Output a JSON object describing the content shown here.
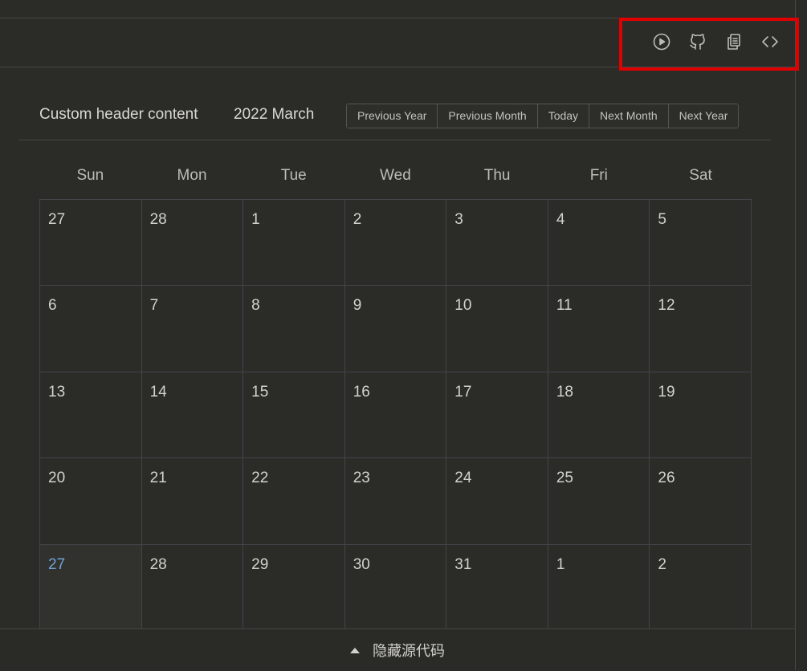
{
  "toolbar": {
    "buttons": [
      {
        "icon": "play-circle-icon",
        "name": "run-button"
      },
      {
        "icon": "github-icon",
        "name": "github-button"
      },
      {
        "icon": "copy-icon",
        "name": "copy-button"
      },
      {
        "icon": "code-icon",
        "name": "code-button"
      }
    ],
    "highlight_color": "#e10000"
  },
  "calendar": {
    "custom_header": "Custom header content",
    "title": "2022 March",
    "nav": {
      "prev_year": "Previous Year",
      "prev_month": "Previous Month",
      "today": "Today",
      "next_month": "Next Month",
      "next_year": "Next Year"
    },
    "weekdays": [
      "Sun",
      "Mon",
      "Tue",
      "Wed",
      "Thu",
      "Fri",
      "Sat"
    ],
    "weeks": [
      [
        "27",
        "28",
        "1",
        "2",
        "3",
        "4",
        "5"
      ],
      [
        "6",
        "7",
        "8",
        "9",
        "10",
        "11",
        "12"
      ],
      [
        "13",
        "14",
        "15",
        "16",
        "17",
        "18",
        "19"
      ],
      [
        "20",
        "21",
        "22",
        "23",
        "24",
        "25",
        "26"
      ],
      [
        "27",
        "28",
        "29",
        "30",
        "31",
        "1",
        "2"
      ]
    ],
    "today_color": "#6fa3d6"
  },
  "footer": {
    "label": "隐藏源代码"
  }
}
